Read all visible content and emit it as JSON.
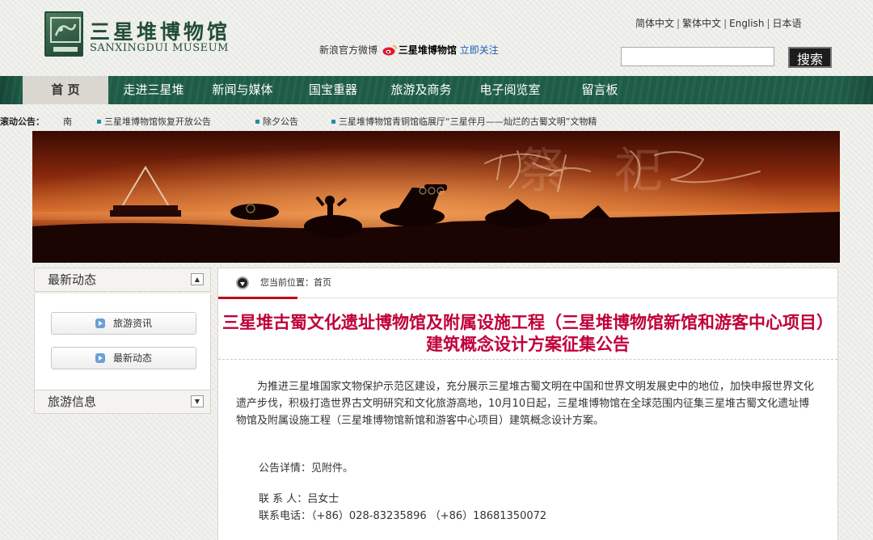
{
  "header": {
    "logo_cn": "三星堆博物馆",
    "logo_en": "SANXINGDUI MUSEUM",
    "weibo": {
      "prefix": "新浪官方微博",
      "name": "三星堆博物馆",
      "follow": "立即关注"
    },
    "languages": [
      "简体中文",
      "繁体中文",
      "English",
      "日本语"
    ],
    "search": {
      "placeholder": "",
      "button": "搜索"
    }
  },
  "nav": {
    "items": [
      "首 页",
      "走进三星堆",
      "新闻与媒体",
      "国宝重器",
      "旅游及商务",
      "电子阅览室",
      "留言板"
    ],
    "active_index": 0
  },
  "ticker": {
    "label": "滚动公告：",
    "items": [
      "南",
      "三星堆博物馆恢复开放公告",
      "除夕公告",
      "三星堆博物馆青铜馆临展厅“三星伴月——灿烂的古蜀文明”文物精"
    ]
  },
  "banner": {
    "art_text": "祭祀"
  },
  "sidebar": {
    "section1": {
      "title": "最新动态",
      "links": [
        "旅游资讯",
        "最新动态"
      ]
    },
    "section2": {
      "title": "旅游信息"
    }
  },
  "main": {
    "breadcrumb": "您当前位置：首页",
    "title": "三星堆古蜀文化遗址博物馆及附属设施工程（三星堆博物馆新馆和游客中心项目）建筑概念设计方案征集公告",
    "body": "为推进三星堆国家文物保护示范区建设，充分展示三星堆古蜀文明在中国和世界文明发展史中的地位，加快申报世界文化遗产步伐，积极打造世界古文明研究和文化旅游高地，10月10日起，三星堆博物馆在全球范围内征集三星堆古蜀文化遗址博物馆及附属设施工程（三星堆博物馆新馆和游客中心项目）建筑概念设计方案。",
    "details": "公告详情：见附件。",
    "contact": "联 系 人：吕女士",
    "phone": "联系电话：（+86）028-83235896 （+86）18681350072"
  },
  "colors": {
    "nav_bg": "#1e5c48",
    "title_red": "#c0003a",
    "brand_green": "#224d37"
  }
}
